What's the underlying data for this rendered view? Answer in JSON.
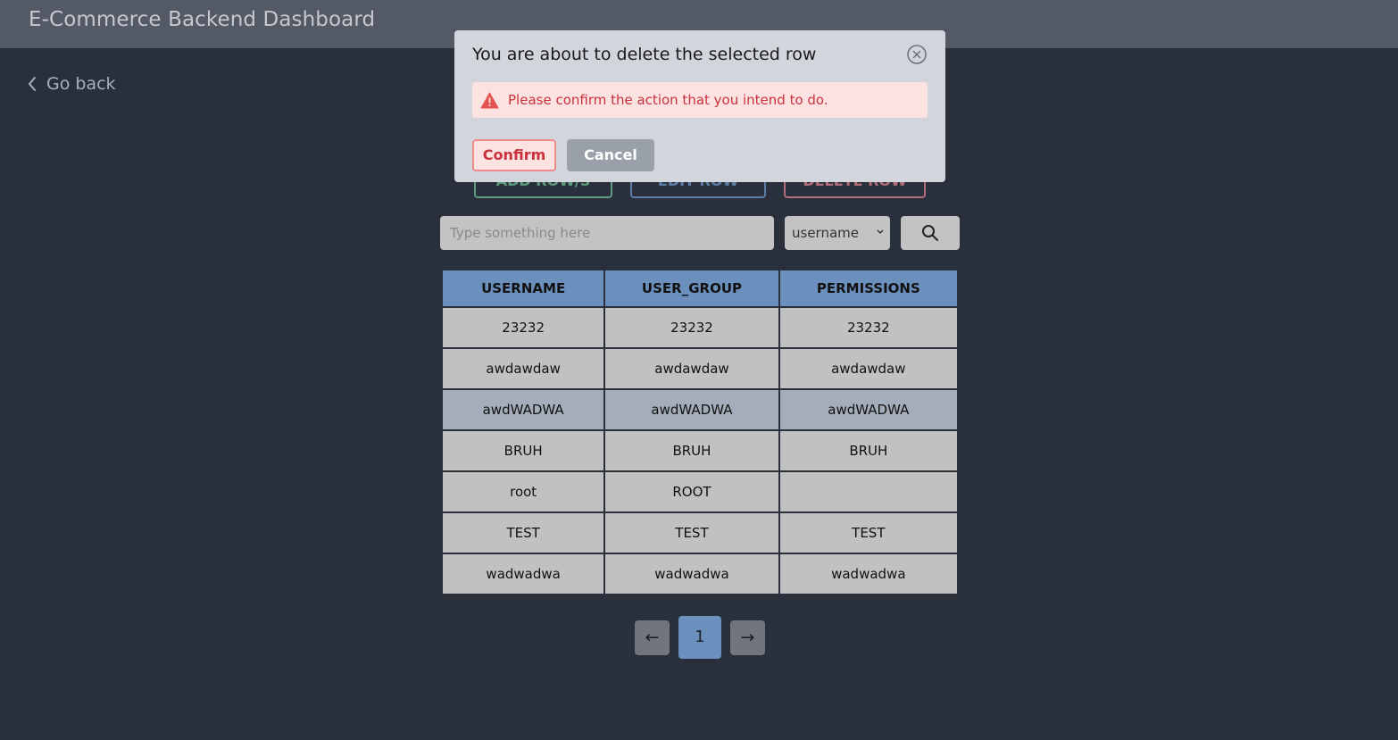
{
  "header": {
    "title": "E-Commerce Backend Dashboard"
  },
  "nav": {
    "go_back_label": "Go back"
  },
  "actions": {
    "add_label": "ADD ROW/S",
    "edit_label": "EDIT ROW",
    "delete_label": "DELETE ROW"
  },
  "search": {
    "placeholder": "Type something here",
    "column_selected": "username",
    "search_icon": "search-icon"
  },
  "table": {
    "columns": [
      "USERNAME",
      "USER_GROUP",
      "PERMISSIONS"
    ],
    "rows": [
      [
        "23232",
        "23232",
        "23232"
      ],
      [
        "awdawdaw",
        "awdawdaw",
        "awdawdaw"
      ],
      [
        "awdWADWA",
        "awdWADWA",
        "awdWADWA"
      ],
      [
        "BRUH",
        "BRUH",
        "BRUH"
      ],
      [
        "root",
        "ROOT",
        ""
      ],
      [
        "TEST",
        "TEST",
        "TEST"
      ],
      [
        "wadwadwa",
        "wadwadwa",
        "wadwadwa"
      ]
    ],
    "selected_row_index": 2
  },
  "pagination": {
    "prev": "←",
    "current": "1",
    "next": "→"
  },
  "dialog": {
    "title": "You are about to delete the selected row",
    "alert_text": "Please confirm the action that you intend to do.",
    "confirm_label": "Confirm",
    "cancel_label": "Cancel"
  },
  "colors": {
    "background": "#2a303b",
    "header_bar": "#545a65",
    "accent_blue": "#6b90bd",
    "danger": "#c8323c",
    "selected_row": "#a4adba"
  }
}
